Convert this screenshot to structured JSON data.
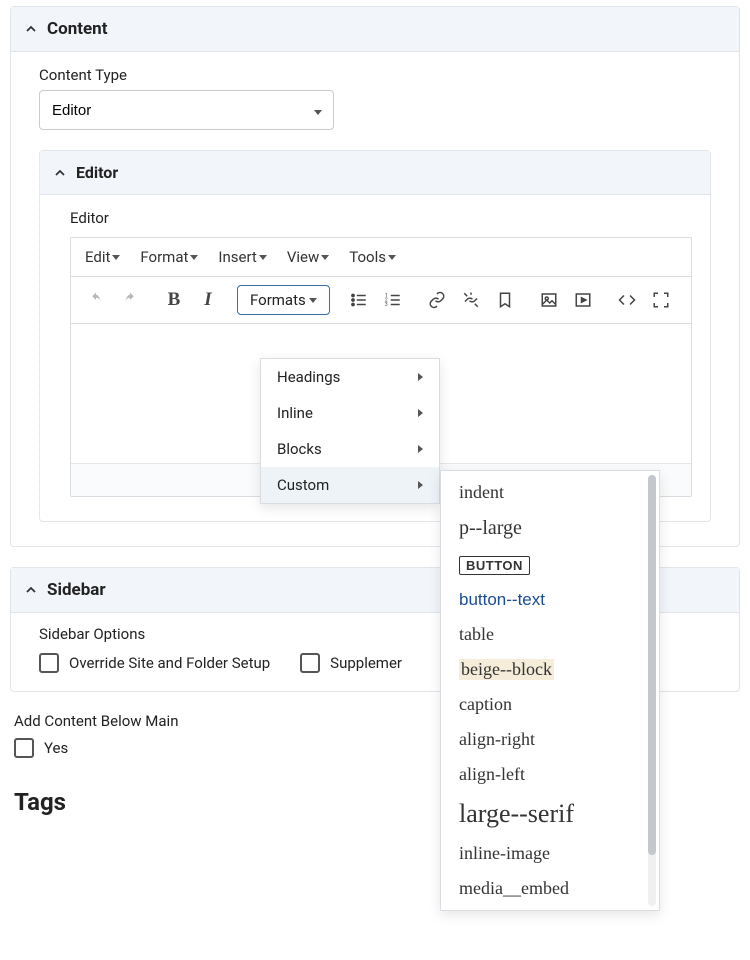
{
  "content": {
    "section_title": "Content",
    "content_type_label": "Content Type",
    "content_type_value": "Editor",
    "editor_section_title": "Editor",
    "editor_field_label": "Editor"
  },
  "menubar": {
    "edit": "Edit",
    "format": "Format",
    "insert": "Insert",
    "view": "View",
    "tools": "Tools"
  },
  "toolbar": {
    "formats_button": "Formats"
  },
  "formats_menu": {
    "headings": "Headings",
    "inline": "Inline",
    "blocks": "Blocks",
    "custom": "Custom"
  },
  "custom_menu": {
    "indent": "indent",
    "p_large": "p--large",
    "button": "BUTTON",
    "button_text": "button--text",
    "table": "table",
    "beige_block": "beige--block",
    "caption": "caption",
    "align_right": "align-right",
    "align_left": "align-left",
    "large_serif": "large--serif",
    "inline_image": "inline-image",
    "media_embed": "media__embed"
  },
  "sidebar": {
    "section_title": "Sidebar",
    "options_label": "Sidebar Options",
    "override_label": "Override Site and Folder Setup",
    "supplementary_label": "Supplemer"
  },
  "add_content": {
    "label": "Add Content Below Main",
    "yes_label": "Yes"
  },
  "tags": {
    "heading": "Tags"
  }
}
